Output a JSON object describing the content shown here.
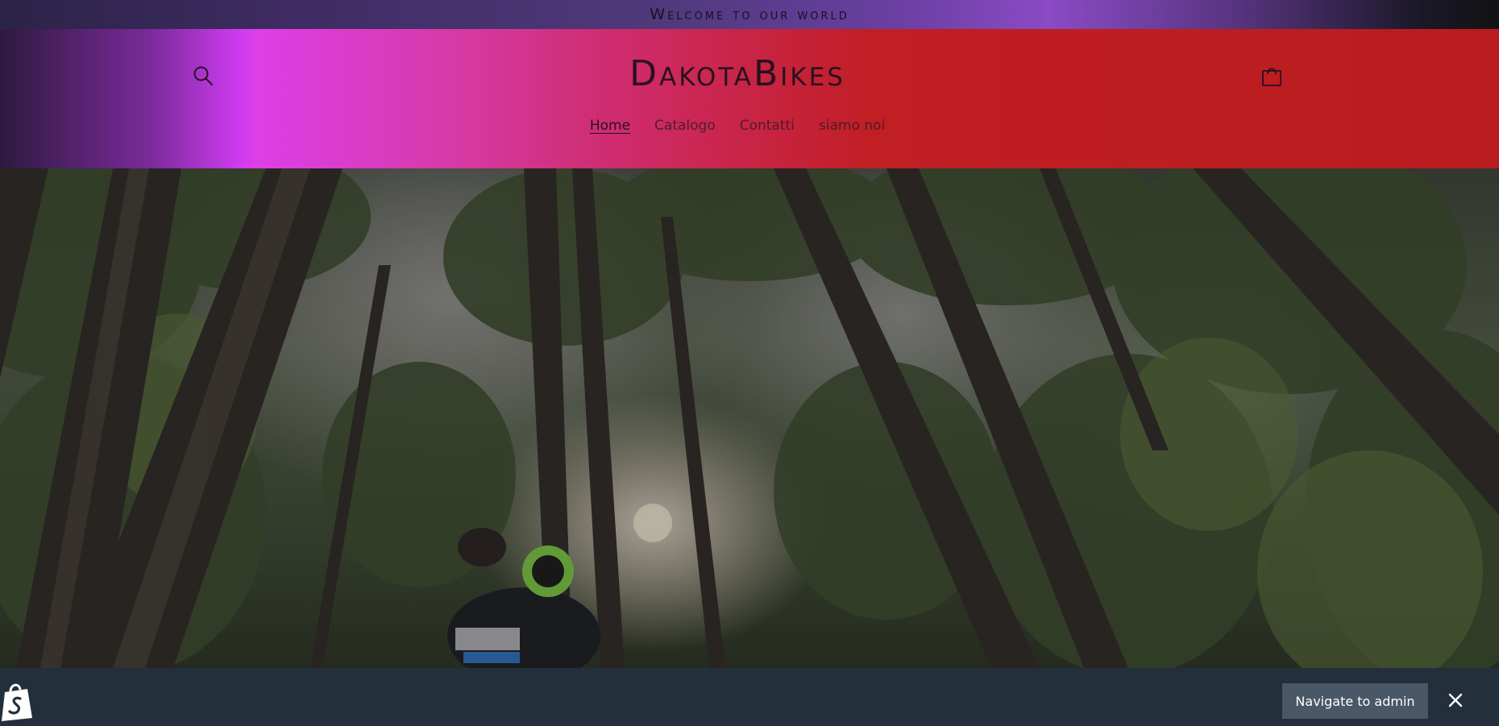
{
  "announcement": {
    "text": "Welcome to our world"
  },
  "header": {
    "logo_text": "DakotaBikes",
    "search_icon": "search-icon",
    "cart_icon": "shopping-bag-icon",
    "nav": [
      {
        "label": "Home",
        "active": true
      },
      {
        "label": "Catalogo",
        "active": false
      },
      {
        "label": "Contatti",
        "active": false
      },
      {
        "label": "siamo noi",
        "active": false
      }
    ]
  },
  "hero": {
    "image_subject": "forest-with-bike-rider-photo"
  },
  "admin_bar": {
    "logo_icon": "shopify-bag-icon",
    "navigate_label": "Navigate to admin",
    "close_icon": "close-icon"
  },
  "colors": {
    "header_red": "#b91c1f",
    "header_magenta": "#dc3fe8",
    "admin_bar_bg": "#25303e",
    "admin_button_bg": "#4a5766"
  }
}
